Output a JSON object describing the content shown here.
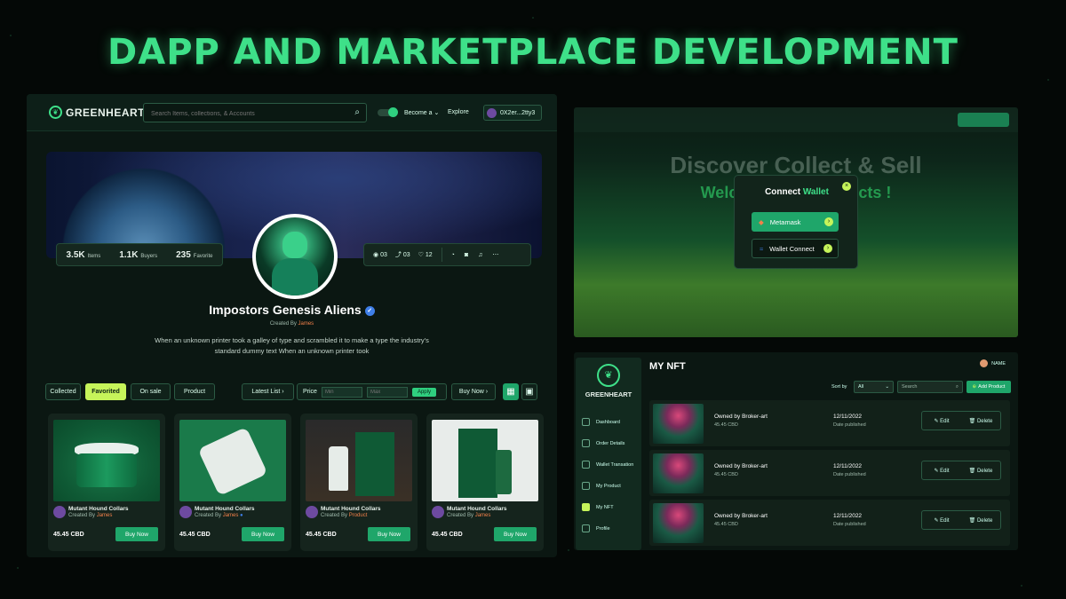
{
  "headline": "DAPP AND MARKETPLACE DEVELOPMENT",
  "marketplace": {
    "logo": "GREENHEART",
    "search_placeholder": "Search Items, collections, & Accounts",
    "become": "Become a ⌄",
    "explore": "Explore",
    "wallet": "0X2er...2tty3",
    "stats": {
      "items_value": "3.5K",
      "items_label": "Items",
      "buyers_value": "1.1K",
      "buyers_label": "Buyers",
      "favorite_value": "235",
      "favorite_label": "Favorite"
    },
    "actions": {
      "views": "03",
      "shares": "03",
      "likes": "12"
    },
    "profile": {
      "name": "Impostors Genesis Aliens",
      "created_prefix": "Created By",
      "creator": "James",
      "description": "When an unknown printer took a galley of type and scrambled it to make a type the industry's standard dummy text  When an unknown printer took"
    },
    "filters": {
      "collected": "Collected",
      "favorited": "Favorited",
      "on_sale": "On sale",
      "product": "Product",
      "latest": "Latest List ›",
      "price": "Price",
      "min": "Min",
      "max": "Max",
      "apply": "Apply",
      "buy_now": "Buy Now ›"
    },
    "cards": [
      {
        "title": "Mutant Hound Collars",
        "by": "Created By",
        "creator": "James",
        "price": "45.45 CBD",
        "button": "Buy Now"
      },
      {
        "title": "Mutant Hound Collars",
        "by": "Created By",
        "creator": "James",
        "price": "45.45 CBD",
        "button": "Buy Now"
      },
      {
        "title": "Mutant Hound Collars",
        "by": "Created By",
        "creator": "Product",
        "price": "45.45 CBD",
        "button": "Buy Now"
      },
      {
        "title": "Mutant Hound Collars",
        "by": "Created By",
        "creator": "James",
        "price": "45.45 CBD",
        "button": "Buy Now"
      }
    ]
  },
  "connect": {
    "bg_title": "Discover Collect & Sell",
    "bg_subtitle": "Welcome to ... Products !",
    "title_a": "Connect",
    "title_b": "Wallet",
    "metamask": "Metamask",
    "wallet_connect": "Wallet Connect"
  },
  "dashboard": {
    "logo": "GREENHEART",
    "title": "MY NFT",
    "user": "NAME",
    "sidebar": [
      "Dashboard",
      "Order Details",
      "Wallet Transation",
      "My Product",
      "My NFT",
      "Profile"
    ],
    "sort_label": "Sort by",
    "sort_value": "All",
    "search_placeholder": "Search",
    "add_product": "Add Product",
    "rows": [
      {
        "owner": "Owned by Broker-art",
        "price": "45.45 CBD",
        "date": "12/11/2022",
        "date_label": "Date published",
        "edit": "Edit",
        "delete": "Delete"
      },
      {
        "owner": "Owned by Broker-art",
        "price": "45.45 CBD",
        "date": "12/11/2022",
        "date_label": "Date published",
        "edit": "Edit",
        "delete": "Delete"
      },
      {
        "owner": "Owned by Broker-art",
        "price": "45.45 CBD",
        "date": "12/11/2022",
        "date_label": "Date published",
        "edit": "Edit",
        "delete": "Delete"
      }
    ]
  },
  "colors": {
    "accent": "#3ee089",
    "lime": "#c6f45a",
    "button": "#1fa66a",
    "creator": "#f2804a"
  }
}
